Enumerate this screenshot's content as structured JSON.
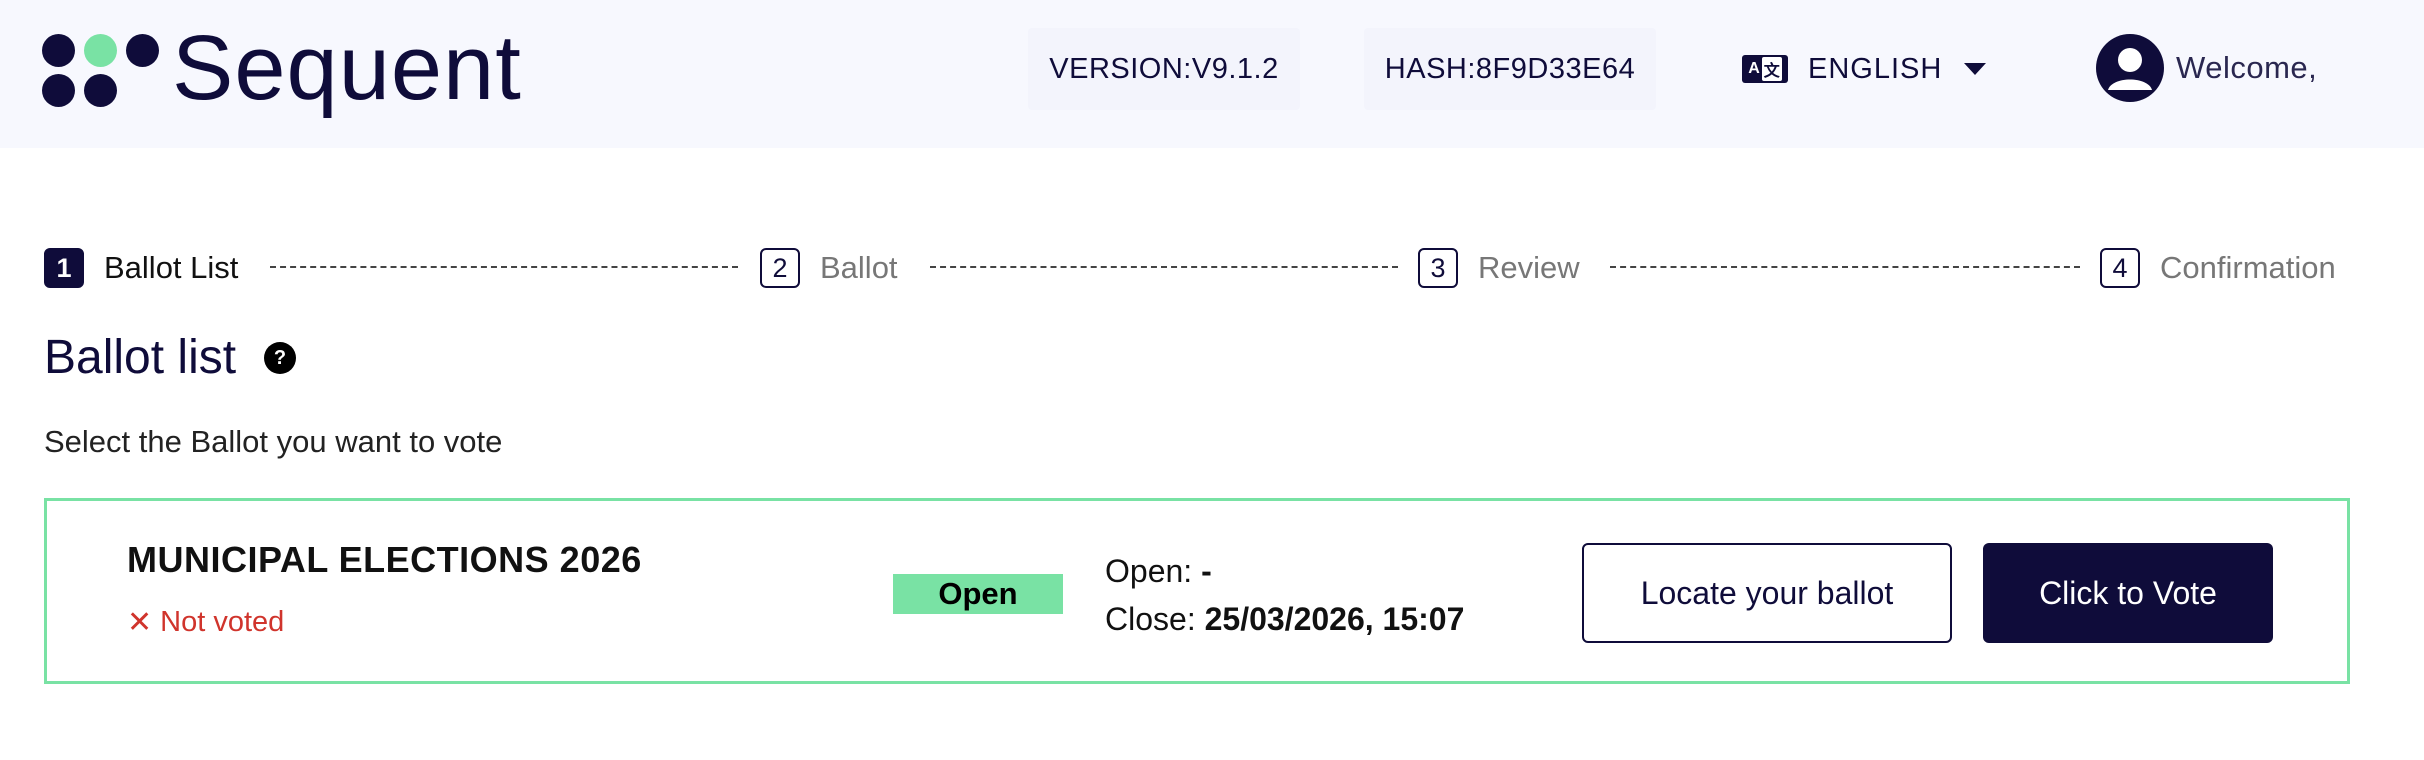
{
  "header": {
    "logo_text": "Sequent",
    "version": "VERSION:V9.1.2",
    "hash": "HASH:8F9D33E64",
    "language": "ENGLISH",
    "welcome": "Welcome,"
  },
  "stepper": {
    "steps": [
      {
        "number": "1",
        "label": "Ballot List"
      },
      {
        "number": "2",
        "label": "Ballot"
      },
      {
        "number": "3",
        "label": "Review"
      },
      {
        "number": "4",
        "label": "Confirmation"
      }
    ]
  },
  "main": {
    "title": "Ballot list",
    "subtitle": "Select the Ballot you want to vote"
  },
  "ballot": {
    "name": "MUNICIPAL ELECTIONS 2026",
    "vote_status": "Not voted",
    "status_badge": "Open",
    "open_label": "Open:",
    "open_value": "-",
    "close_label": "Close:",
    "close_value": "25/03/2026, 15:07",
    "locate_button": "Locate your ballot",
    "vote_button": "Click to Vote"
  },
  "colors": {
    "brand": "#0f0c3a",
    "accent_green": "#79e2a4",
    "error_red": "#d0342c",
    "header_bg": "#f7f8fe"
  },
  "icons": {
    "logo": "logo-dots",
    "language": "translate-icon",
    "dropdown": "caret-down-icon",
    "user": "user-avatar-icon",
    "help": "help-icon",
    "not_voted": "close-icon"
  }
}
